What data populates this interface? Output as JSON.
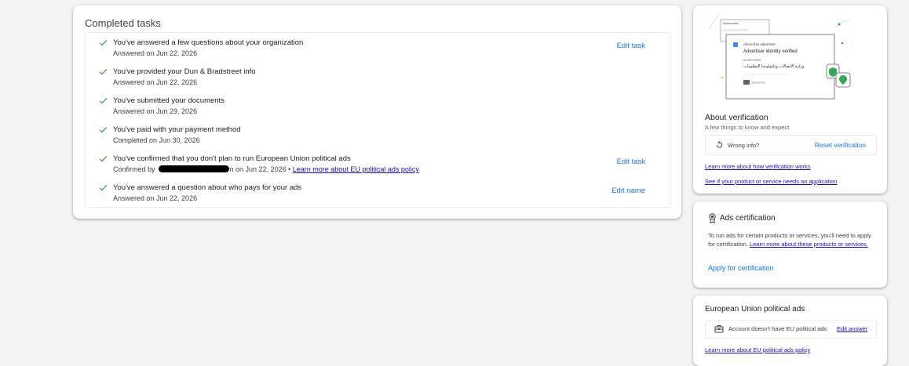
{
  "completed_tasks": {
    "title": "Completed tasks",
    "tasks": [
      {
        "title": "You've answered a few questions about your organization",
        "subtitle": "Answered on Jun 22, 2026",
        "action": "Edit task"
      },
      {
        "title": "You've provided your Dun & Bradstreet info",
        "subtitle": "Answered on Jun 22, 2026",
        "action": ""
      },
      {
        "title": "You've submitted your documents",
        "subtitle": "Answered on Jun 29, 2026",
        "action": ""
      },
      {
        "title": "You've paid with your payment method",
        "subtitle": "Completed on Jun 30, 2026",
        "action": ""
      },
      {
        "title": "You've confirmed that you don't plan to run European Union political ads",
        "subtitle_prefix": "Confirmed by",
        "subtitle_suffix": "n on Jun 22, 2026 •",
        "subtitle_link": "Learn more about EU political ads policy",
        "action": "Edit task"
      },
      {
        "title": "You've answered a question about who pays for your ads",
        "subtitle": "Answered on Jun 22, 2026",
        "action": "Edit name"
      }
    ]
  },
  "verification": {
    "illustration": {
      "sponsored": "Sponsored",
      "about_advertiser": "About this advertiser",
      "verified": "Advertiser identity verified",
      "advertiser_label": "ADVERTISER",
      "advertiser_name": "وزارة الاتصالات وتكنولوجيا المعلومات"
    },
    "title": "About verification",
    "subtitle": "A few things to know and expect",
    "wrong_info": "Wrong info?",
    "reset": "Reset verification",
    "link1": "Learn more about how verification works",
    "link2": "See if your product or service needs an application"
  },
  "certification": {
    "title": "Ads certification",
    "body": "To run ads for certain products or services, you'll need to apply for certification.",
    "body_link": "Learn more about these products or services.",
    "apply": "Apply for certification"
  },
  "eu_ads": {
    "title": "European Union political ads",
    "status": "Account doesn't have EU political ads",
    "edit": "Edit answer",
    "link": "Learn more about EU political ads policy"
  },
  "colors": {
    "accent": "#1a73e8",
    "check": "#1e8e3e",
    "link": "#1a0dab",
    "background": "#f1f3f4"
  }
}
